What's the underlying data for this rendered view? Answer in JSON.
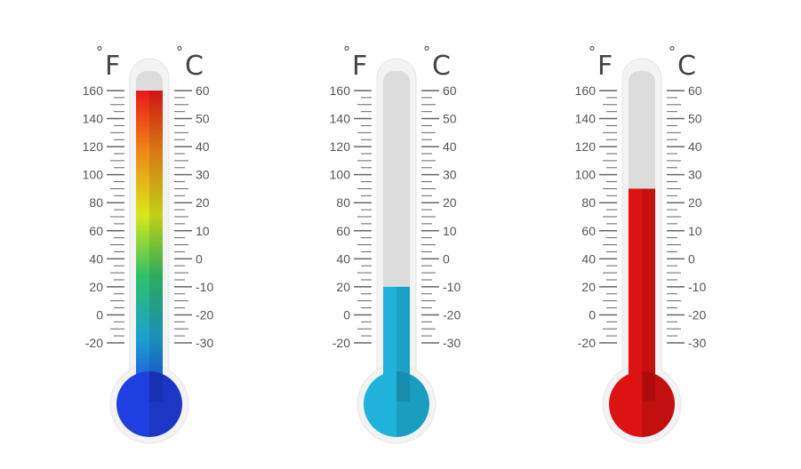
{
  "units": {
    "f": "F",
    "c": "C",
    "deg": "°"
  },
  "f_ticks": [
    "160",
    "140",
    "120",
    "100",
    "80",
    "60",
    "40",
    "20",
    "0",
    "-20"
  ],
  "c_ticks": [
    "60",
    "50",
    "40",
    "30",
    "20",
    "10",
    "0",
    "-10",
    "-20",
    "-30"
  ],
  "thermometers": [
    {
      "name": "gradient",
      "level_f": 160,
      "style": "gradient",
      "colors": [
        "#1f3fe0",
        "#1d9fd0",
        "#2fbf6a",
        "#d8e81a",
        "#f08a18",
        "#e81818"
      ]
    },
    {
      "name": "cold",
      "level_f": 20,
      "style": "solid",
      "colors": [
        "#1fb3dc",
        "#149cc8"
      ]
    },
    {
      "name": "hot",
      "level_f": 90,
      "style": "solid",
      "colors": [
        "#dd1212",
        "#b00a0a"
      ]
    }
  ],
  "colors": {
    "tube_bg": "#dcdcdc",
    "glass": "#f3f3f3",
    "tick": "#666666",
    "text": "#555555"
  }
}
